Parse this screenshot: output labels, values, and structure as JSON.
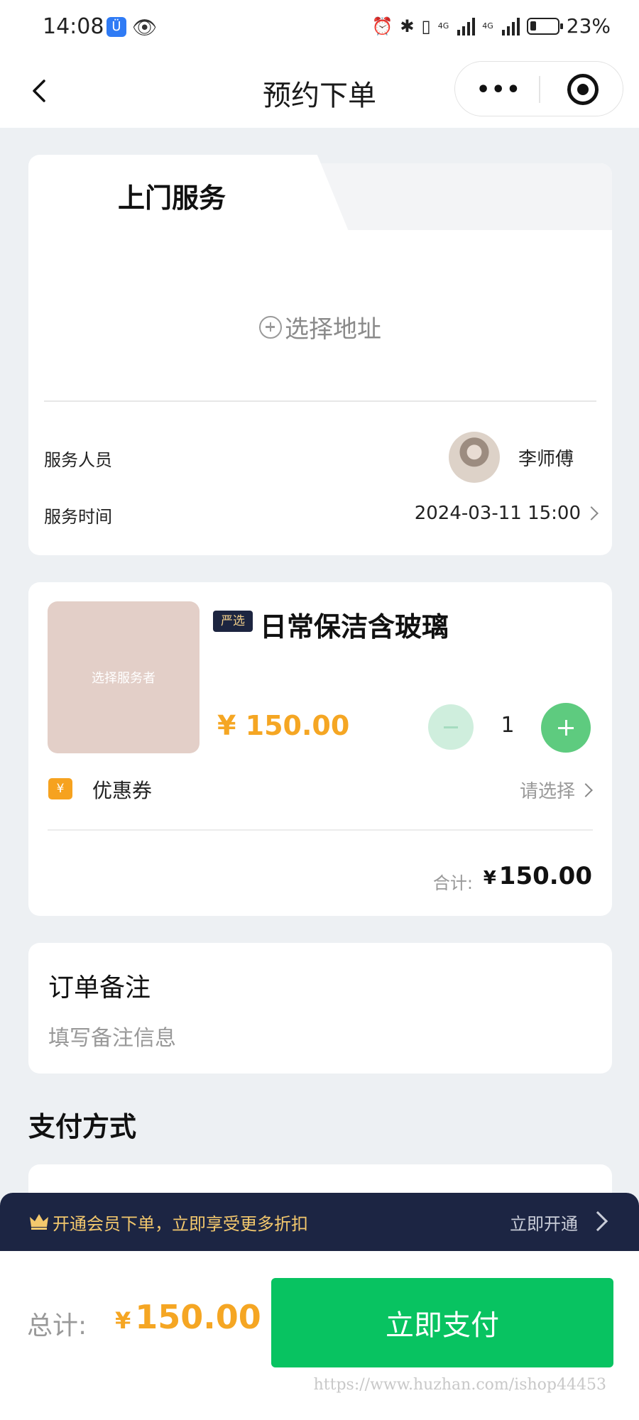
{
  "status_bar": {
    "time": "14:08",
    "battery_percent": "23%",
    "battery_level": 23,
    "network_1": "4G",
    "network_2": "4G"
  },
  "nav": {
    "title": "预约下单",
    "more_label": "•••"
  },
  "service_card": {
    "active_tab": "上门服务",
    "address_placeholder": "选择地址",
    "staff_label": "服务人员",
    "staff_name": "李师傅",
    "time_label": "服务时间",
    "time_value": "2024-03-11 15:00"
  },
  "product_card": {
    "image_text": "选择服务者",
    "tag": "严选",
    "name": "日常保洁含玻璃",
    "price": "¥ 150.00",
    "quantity": "1",
    "coupon_icon": "¥",
    "coupon_label": "优惠券",
    "coupon_action": "请选择",
    "total_label": "合计:",
    "total_currency": "¥",
    "total_value": "150.00"
  },
  "remark": {
    "title": "订单备注",
    "placeholder": "填写备注信息"
  },
  "payment": {
    "title": "支付方式"
  },
  "member_bar": {
    "text": "开通会员下单，立即享受更多折扣",
    "action": "立即开通"
  },
  "bottom_bar": {
    "total_label": "总计:",
    "currency": "¥",
    "total_value": "150.00",
    "pay_button": "立即支付"
  },
  "watermark": "https://www.huzhan.com/ishop44453",
  "colors": {
    "accent_green": "#08c361",
    "price_orange": "#f5a623",
    "member_navy": "#1c2543",
    "member_gold": "#f3c86d"
  }
}
